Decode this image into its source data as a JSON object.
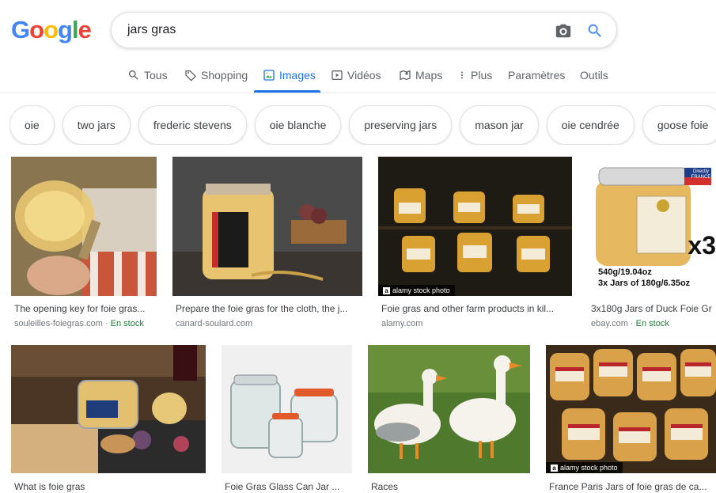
{
  "logo": {
    "letters": [
      "G",
      "o",
      "o",
      "g",
      "l",
      "e"
    ],
    "colors": [
      "#4285F4",
      "#EA4335",
      "#FBBC05",
      "#4285F4",
      "#34A853",
      "#EA4335"
    ]
  },
  "search": {
    "query": "jars gras"
  },
  "tabs": [
    {
      "label": "Tous",
      "icon": "search-icon"
    },
    {
      "label": "Shopping",
      "icon": "tag-icon"
    },
    {
      "label": "Images",
      "icon": "image-icon",
      "active": true
    },
    {
      "label": "Vidéos",
      "icon": "play-icon"
    },
    {
      "label": "Maps",
      "icon": "map-icon"
    },
    {
      "label": "Plus",
      "icon": "more-vert-icon"
    },
    {
      "label": "Paramètres"
    },
    {
      "label": "Outils"
    }
  ],
  "chips": [
    "oie",
    "two jars",
    "frederic stevens",
    "oie blanche",
    "preserving jars",
    "mason jar",
    "oie cendrée",
    "goose foie",
    "oie"
  ],
  "results": [
    {
      "title": "The opening key for foie gras...",
      "source": "souleilles-foiegras.com",
      "stock": "En stock"
    },
    {
      "title": "Prepare the foie gras for the cloth, the j...",
      "source": "canard-soulard.com"
    },
    {
      "title": "Foie gras and other farm products in kil...",
      "source": "alamy.com",
      "watermark": "alamy stock photo"
    },
    {
      "title": "3x180g Jars of Duck Foie Gr",
      "source": "ebay.com",
      "stock": "En stock",
      "overlay": {
        "line1": "540g/19.04oz",
        "line2": "3x Jars of 180g/6.35oz",
        "badge": "x3",
        "flag": "Directly FRANCE"
      }
    },
    {
      "title": "What is foie gras",
      "source": ""
    },
    {
      "title": "Foie Gras Glass Can Jar ...",
      "source": ""
    },
    {
      "title": "Races",
      "source": ""
    },
    {
      "title": "France Paris Jars of foie gras de ca...",
      "source": "",
      "watermark": "alamy stock photo"
    }
  ],
  "colors": {
    "accent": "#1a73e8",
    "stock": "#188038"
  }
}
